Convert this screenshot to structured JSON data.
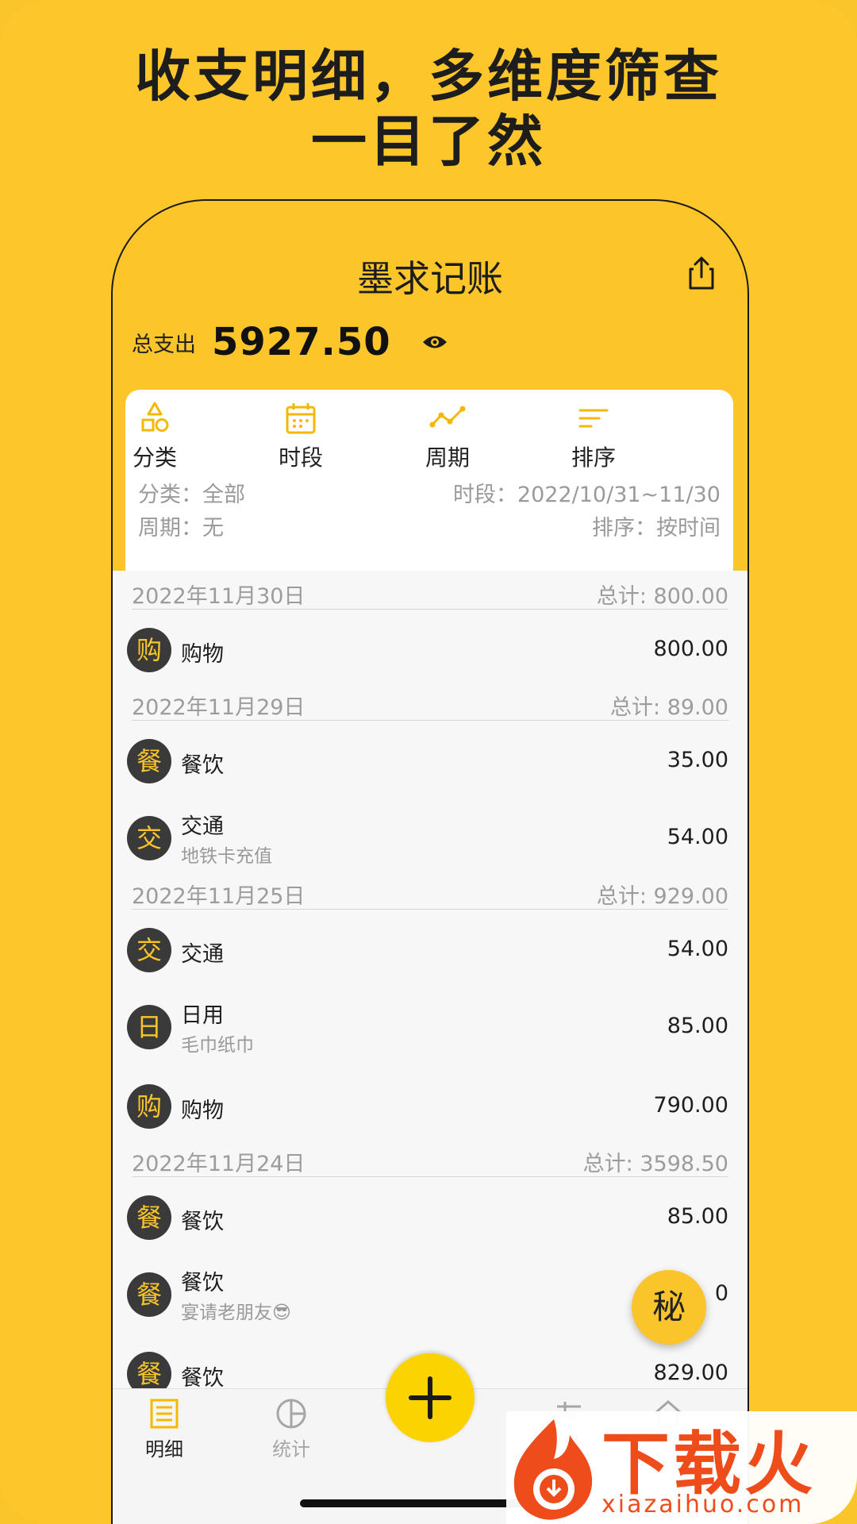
{
  "headline": {
    "line1": "收支明细，多维度筛查",
    "line2": "一目了然"
  },
  "app": {
    "title": "墨求记账",
    "total_label": "总支出",
    "total_value": "5927.50"
  },
  "filters": {
    "buttons": [
      {
        "label": "分类",
        "icon": "category-shapes-icon"
      },
      {
        "label": "时段",
        "icon": "calendar-icon"
      },
      {
        "label": "周期",
        "icon": "trend-line-icon"
      },
      {
        "label": "排序",
        "icon": "sort-lines-icon"
      }
    ],
    "info": {
      "category": "分类：全部",
      "range": "时段：2022/10/31~11/30",
      "cycle": "周期：无",
      "sort": "排序：按时间"
    }
  },
  "days": [
    {
      "date": "2022年11月30日",
      "sum": "总计: 800.00",
      "entries": [
        {
          "badge": "购",
          "name": "购物",
          "note": "",
          "amount": "800.00"
        }
      ]
    },
    {
      "date": "2022年11月29日",
      "sum": "总计: 89.00",
      "entries": [
        {
          "badge": "餐",
          "name": "餐饮",
          "note": "",
          "amount": "35.00"
        },
        {
          "badge": "交",
          "name": "交通",
          "note": "地铁卡充值",
          "amount": "54.00"
        }
      ]
    },
    {
      "date": "2022年11月25日",
      "sum": "总计: 929.00",
      "entries": [
        {
          "badge": "交",
          "name": "交通",
          "note": "",
          "amount": "54.00"
        },
        {
          "badge": "日",
          "name": "日用",
          "note": "毛巾纸巾",
          "amount": "85.00"
        },
        {
          "badge": "购",
          "name": "购物",
          "note": "",
          "amount": "790.00"
        }
      ]
    },
    {
      "date": "2022年11月24日",
      "sum": "总计: 3598.50",
      "entries": [
        {
          "badge": "餐",
          "name": "餐饮",
          "note": "",
          "amount": "85.00"
        },
        {
          "badge": "餐",
          "name": "餐饮",
          "note": "宴请老朋友😎",
          "amount": "0"
        },
        {
          "badge": "餐",
          "name": "餐饮",
          "note": "",
          "amount": "829.00"
        }
      ]
    }
  ],
  "fab_label": "秘",
  "tabs": [
    {
      "label": "明细",
      "icon": "list-icon",
      "active": true
    },
    {
      "label": "统计",
      "icon": "pie-chart-icon",
      "active": false
    }
  ],
  "colors": {
    "brand_yellow": "#F9C52A",
    "badge_dark": "#3a3a3a",
    "watermark_red": "#EE4D1B"
  },
  "watermark": {
    "text": "下载火",
    "sub": "xiazaihuo.com"
  }
}
